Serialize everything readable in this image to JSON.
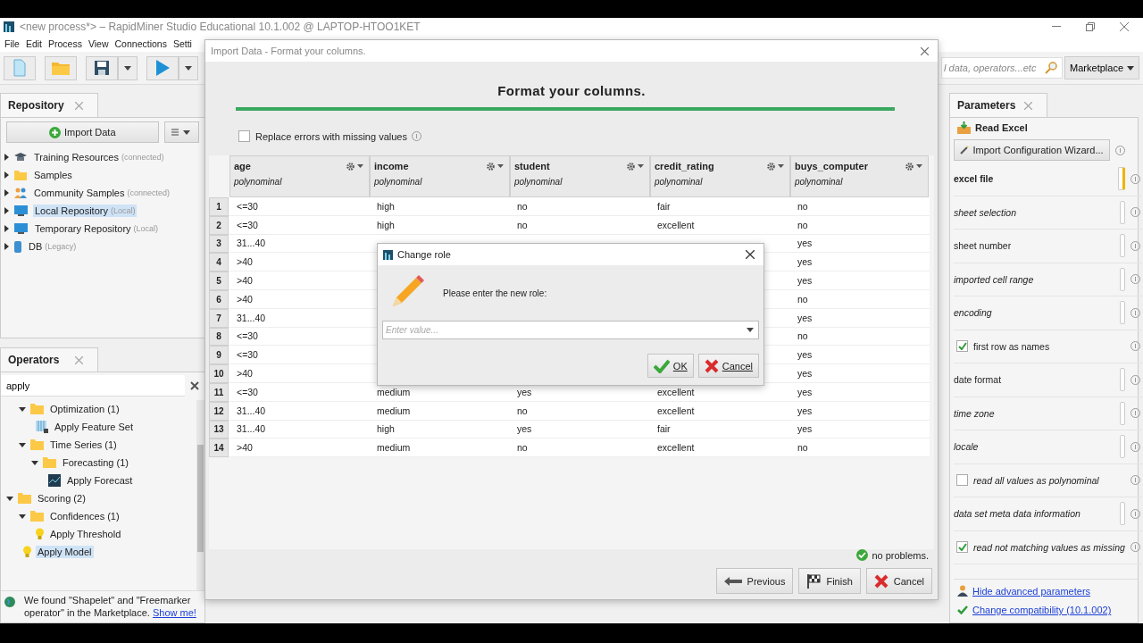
{
  "app_window": {
    "title": "<new process*> – RapidMiner Studio Educational 10.1.002 @ LAPTOP-HTOO1KET"
  },
  "menu": [
    {
      "label": "File"
    },
    {
      "label": "Edit"
    },
    {
      "label": "Process"
    },
    {
      "label": "View"
    },
    {
      "label": "Connections"
    },
    {
      "label": "Setti"
    }
  ],
  "toolbar": {
    "search_placeholder": "l data, operators...etc",
    "marketplace": "Marketplace"
  },
  "repository": {
    "title": "Repository",
    "import_button": "Import Data",
    "items": [
      {
        "name": "Training Resources",
        "note": "(connected)",
        "kind": "training",
        "selected": false
      },
      {
        "name": "Samples",
        "kind": "folder",
        "selected": false
      },
      {
        "name": "Community Samples",
        "note": "(connected)",
        "kind": "community",
        "selected": false
      },
      {
        "name": "Local Repository",
        "note": "(Local)",
        "kind": "local",
        "selected": true
      },
      {
        "name": "Temporary Repository",
        "note": "(Local)",
        "kind": "local",
        "selected": false
      },
      {
        "name": "DB",
        "note": "(Legacy)",
        "kind": "database",
        "selected": false
      }
    ]
  },
  "operators": {
    "title": "Operators",
    "search": "apply",
    "tree": [
      {
        "children": [
          {
            "label": "Optimization (1)",
            "kind": "folder",
            "expanded": true,
            "selected": false,
            "children": [
              {
                "label": "Apply Feature Set",
                "kind": "feature",
                "selected": false
              }
            ]
          },
          {
            "label": "Time Series (1)",
            "kind": "folder",
            "expanded": true,
            "selected": false,
            "children": [
              {
                "label": "Forecasting (1)",
                "kind": "folder",
                "expanded": true,
                "selected": false,
                "children": [
                  {
                    "label": "Apply Forecast",
                    "kind": "forecast",
                    "selected": false
                  }
                ]
              }
            ]
          }
        ]
      },
      {
        "label": "Scoring (2)",
        "kind": "folder",
        "expanded": true,
        "selected": false,
        "children": [
          {
            "label": "Confidences (1)",
            "kind": "folder",
            "expanded": true,
            "selected": false,
            "children": [
              {
                "label": "Apply Threshold",
                "kind": "bulb",
                "selected": false
              }
            ]
          },
          {
            "label": "Apply Model",
            "kind": "bulb",
            "selected": true
          }
        ]
      }
    ],
    "notice": {
      "text": "We found \"Shapelet\" and \"Freemarker operator\" in the Marketplace.",
      "link": "Show me!"
    }
  },
  "parameters": {
    "title": "Parameters",
    "operator": "Read Excel",
    "wizard_button": "Import Configuration Wizard...",
    "items": [
      {
        "kind": "field",
        "label": "excel file",
        "required": true,
        "expert": false,
        "warning": true
      },
      {
        "kind": "field",
        "label": "sheet selection",
        "required": false,
        "expert": true,
        "warning": false
      },
      {
        "kind": "field",
        "label": "sheet number",
        "required": false,
        "expert": false,
        "warning": false
      },
      {
        "kind": "field",
        "label": "imported cell range",
        "required": false,
        "expert": true,
        "warning": false
      },
      {
        "kind": "field",
        "label": "encoding",
        "required": false,
        "expert": true,
        "warning": false
      },
      {
        "kind": "checkbox",
        "label": "first row as names",
        "required": false,
        "expert": false,
        "checked": true
      },
      {
        "kind": "field",
        "label": "date format",
        "required": false,
        "expert": false,
        "warning": false
      },
      {
        "kind": "field",
        "label": "time zone",
        "required": false,
        "expert": true,
        "warning": false
      },
      {
        "kind": "field",
        "label": "locale",
        "required": false,
        "expert": true,
        "warning": false
      },
      {
        "kind": "checkbox",
        "label": "read all values as polynominal",
        "required": false,
        "expert": true,
        "checked": false
      },
      {
        "kind": "field",
        "label": "data set meta data information",
        "required": false,
        "expert": true,
        "warning": false
      },
      {
        "kind": "checkbox",
        "label": "read not matching values as missing",
        "required": false,
        "expert": true,
        "checked": true
      }
    ],
    "links": [
      "Hide advanced parameters",
      "Change compatibility (10.1.002)"
    ]
  },
  "import_dialog": {
    "title": "Import Data - Format your columns.",
    "heading": "Format your columns.",
    "progress": {
      "level": 1
    },
    "replace_errors": {
      "label": "Replace errors with missing values",
      "checked": false
    },
    "columns": [
      {
        "name": "age",
        "type": "polynominal"
      },
      {
        "name": "income",
        "type": "polynominal"
      },
      {
        "name": "student",
        "type": "polynominal"
      },
      {
        "name": "credit_rating",
        "type": "polynominal"
      },
      {
        "name": "buys_computer",
        "type": "polynominal"
      }
    ],
    "rows": [
      {
        "num": "1",
        "cells": [
          "<=30",
          "high",
          "no",
          "fair",
          "no"
        ]
      },
      {
        "num": "2",
        "cells": [
          "<=30",
          "high",
          "no",
          "excellent",
          "no"
        ]
      },
      {
        "num": "3",
        "cells": [
          "31...40",
          null,
          null,
          null,
          "yes"
        ]
      },
      {
        "num": "4",
        "cells": [
          ">40",
          null,
          null,
          null,
          "yes"
        ]
      },
      {
        "num": "5",
        "cells": [
          ">40",
          null,
          null,
          null,
          "yes"
        ]
      },
      {
        "num": "6",
        "cells": [
          ">40",
          null,
          null,
          null,
          "no"
        ]
      },
      {
        "num": "7",
        "cells": [
          "31...40",
          null,
          null,
          null,
          "yes"
        ]
      },
      {
        "num": "8",
        "cells": [
          "<=30",
          null,
          null,
          null,
          "no"
        ]
      },
      {
        "num": "9",
        "cells": [
          "<=30",
          null,
          null,
          null,
          "yes"
        ]
      },
      {
        "num": "10",
        "cells": [
          ">40",
          null,
          null,
          null,
          "yes"
        ]
      },
      {
        "num": "11",
        "cells": [
          "<=30",
          "medium",
          "yes",
          "excellent",
          "yes"
        ]
      },
      {
        "num": "12",
        "cells": [
          "31...40",
          "medium",
          "no",
          "excellent",
          "yes"
        ]
      },
      {
        "num": "13",
        "cells": [
          "31...40",
          "high",
          "yes",
          "fair",
          "yes"
        ]
      },
      {
        "num": "14",
        "cells": [
          ">40",
          "medium",
          "no",
          "excellent",
          "no"
        ]
      }
    ],
    "status": "no problems.",
    "buttons": [
      {
        "label": "Previous",
        "kind": "previous"
      },
      {
        "label": "Finish",
        "kind": "finish"
      },
      {
        "label": "Cancel",
        "kind": "cancel"
      }
    ]
  },
  "change_role_dialog": {
    "title": "Change role",
    "prompt": "Please enter the new role:",
    "placeholder": "Enter value...",
    "buttons": [
      {
        "label": "OK",
        "kind": "ok"
      },
      {
        "label": "Cancel",
        "kind": "cancel"
      }
    ]
  }
}
